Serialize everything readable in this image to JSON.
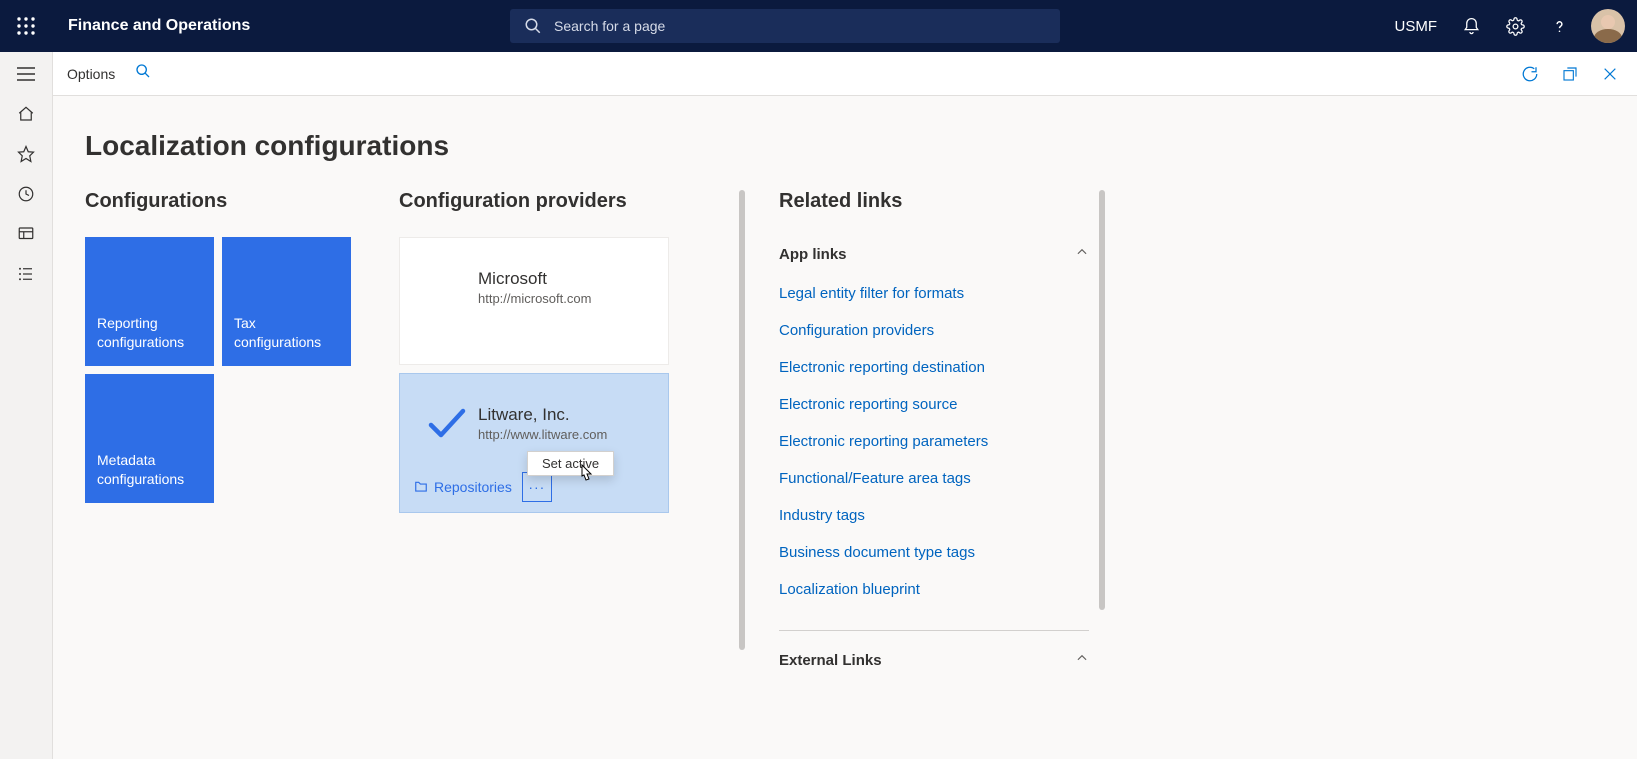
{
  "header": {
    "app_title": "Finance and Operations",
    "search_placeholder": "Search for a page",
    "entity": "USMF"
  },
  "commandbar": {
    "options": "Options"
  },
  "page": {
    "title": "Localization configurations"
  },
  "configurations": {
    "title": "Configurations",
    "tiles": [
      {
        "label": "Reporting configurations"
      },
      {
        "label": "Tax configurations"
      },
      {
        "label": "Metadata configurations"
      }
    ]
  },
  "providers": {
    "title": "Configuration providers",
    "items": [
      {
        "name": "Microsoft",
        "url": "http://microsoft.com",
        "active": false
      },
      {
        "name": "Litware, Inc.",
        "url": "http://www.litware.com",
        "active": true
      }
    ],
    "repositories_label": "Repositories",
    "menu": {
      "set_active": "Set active"
    }
  },
  "related": {
    "title": "Related links",
    "groups": [
      {
        "label": "App links",
        "links": [
          "Legal entity filter for formats",
          "Configuration providers",
          "Electronic reporting destination",
          "Electronic reporting source",
          "Electronic reporting parameters",
          "Functional/Feature area tags",
          "Industry tags",
          "Business document type tags",
          "Localization blueprint"
        ]
      },
      {
        "label": "External Links",
        "links": []
      }
    ]
  }
}
